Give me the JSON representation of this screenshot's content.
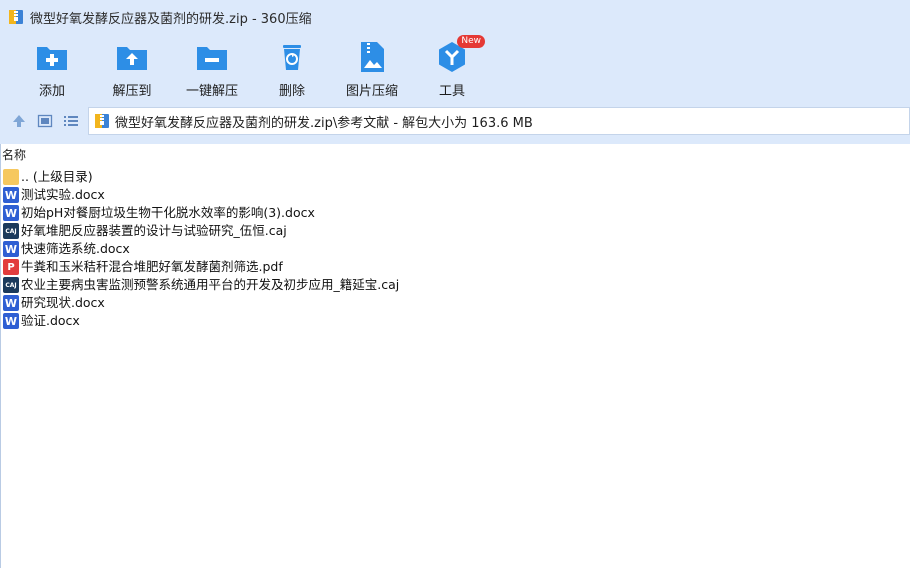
{
  "window": {
    "title": "微型好氧发酵反应器及菌剂的研发.zip - 360压缩"
  },
  "toolbar": {
    "items": [
      {
        "label": "添加",
        "icon": "add-folder-icon"
      },
      {
        "label": "解压到",
        "icon": "extract-to-icon"
      },
      {
        "label": "一键解压",
        "icon": "one-click-extract-icon"
      },
      {
        "label": "删除",
        "icon": "delete-icon"
      },
      {
        "label": "图片压缩",
        "icon": "image-compress-icon"
      },
      {
        "label": "工具",
        "icon": "tools-icon",
        "badge": "New"
      }
    ]
  },
  "nav": {
    "path": "微型好氧发酵反应器及菌剂的研发.zip\\参考文献 - 解包大小为 163.6 MB"
  },
  "list": {
    "column_name": "名称",
    "items": [
      {
        "name": ".. (上级目录)",
        "type": "folder"
      },
      {
        "name": "测试实验.docx",
        "type": "docx"
      },
      {
        "name": "初始pH对餐厨垃圾生物干化脱水效率的影响(3).docx",
        "type": "docx"
      },
      {
        "name": "好氧堆肥反应器装置的设计与试验研究_伍恒.caj",
        "type": "caj"
      },
      {
        "name": "快速筛选系统.docx",
        "type": "docx"
      },
      {
        "name": "牛粪和玉米秸秆混合堆肥好氧发酵菌剂筛选.pdf",
        "type": "pdf"
      },
      {
        "name": "农业主要病虫害监测预警系统通用平台的开发及初步应用_籍延宝.caj",
        "type": "caj"
      },
      {
        "name": "研究现状.docx",
        "type": "docx"
      },
      {
        "name": "验证.docx",
        "type": "docx"
      }
    ]
  },
  "colors": {
    "accent": "#2d8ee6",
    "toolbar_bg": "#dce9fb"
  }
}
